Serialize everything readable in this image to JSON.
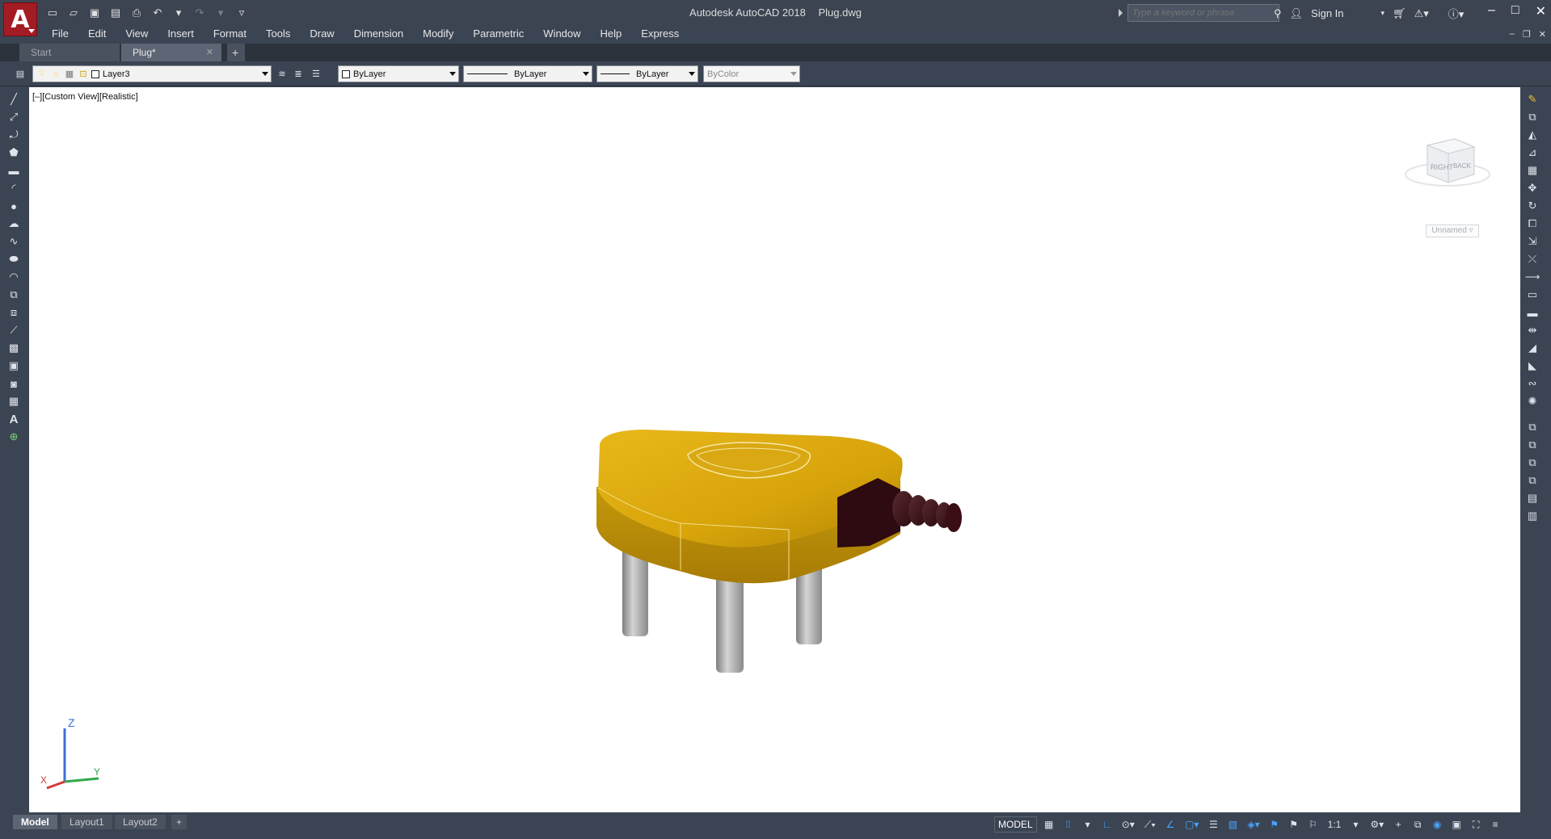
{
  "app": {
    "title": "Autodesk AutoCAD 2018",
    "document": "Plug.dwg",
    "logo_letter": "A"
  },
  "search": {
    "placeholder": "Type a keyword or phrase"
  },
  "account": {
    "sign_in": "Sign In"
  },
  "menu": [
    "File",
    "Edit",
    "View",
    "Insert",
    "Format",
    "Tools",
    "Draw",
    "Dimension",
    "Modify",
    "Parametric",
    "Window",
    "Help",
    "Express"
  ],
  "file_tabs": {
    "start": "Start",
    "current": "Plug*"
  },
  "properties": {
    "layer": "Layer3",
    "color": "ByLayer",
    "linetype": "ByLayer",
    "lineweight": "ByLayer",
    "plotstyle": "ByColor"
  },
  "viewport": {
    "label": "[–][Custom View][Realistic]",
    "viewcube_face_right": "RIGHT",
    "viewcube_face_back": "BACK",
    "named_view": "Unnamed",
    "ucs_z": "Z",
    "ucs_x": "X",
    "ucs_y": "Y"
  },
  "layout_tabs": [
    "Model",
    "Layout1",
    "Layout2"
  ],
  "statusbar": {
    "model": "MODEL",
    "scale": "1:1"
  },
  "colors": {
    "ui_bg": "#3b4453",
    "plug_body": "#d9a50a",
    "plug_pins": "#a9a9a9",
    "cable": "#3a1218",
    "logo_red": "#a41c23"
  }
}
